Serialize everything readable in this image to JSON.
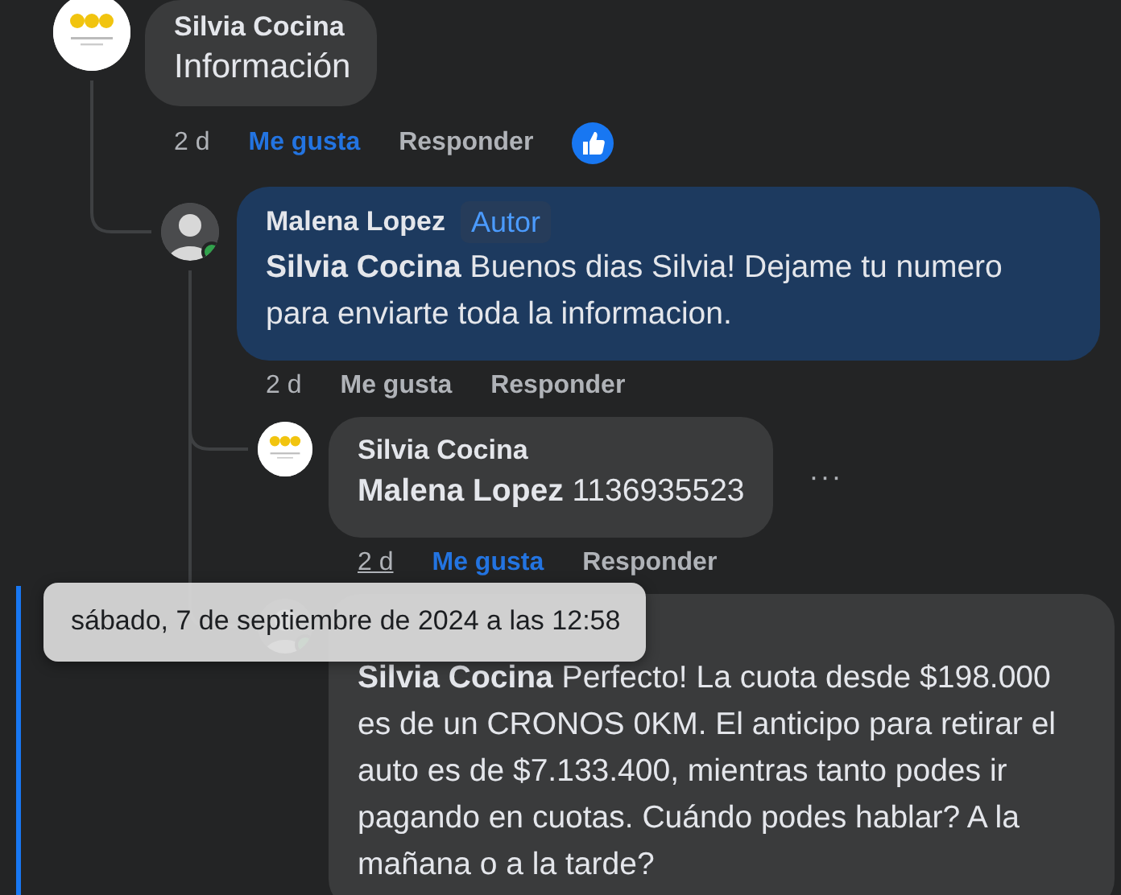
{
  "comments": [
    {
      "author": "Silvia Cocina",
      "avatar": {
        "kind": "logo"
      },
      "by_author": false,
      "text": "Información",
      "time": "2 d",
      "time_hovered": false,
      "like_label": "Me gusta",
      "liked": true,
      "reply_label": "Responder",
      "reactions": [
        {
          "kind": "like"
        }
      ],
      "children": [
        {
          "author": "Malena Lopez",
          "badge": "Autor",
          "avatar": {
            "kind": "person"
          },
          "online": true,
          "by_author": true,
          "text": "**Silvia Cocina** Buenos dias Silvia! Dejame tu numero para enviarte toda la informacion.",
          "time": "2 d",
          "time_hovered": false,
          "like_label": "Me gusta",
          "liked": false,
          "reply_label": "Responder",
          "children": [
            {
              "author": "Silvia Cocina",
              "avatar": {
                "kind": "logo"
              },
              "by_author": false,
              "text": "**Malena Lopez** 1136935523",
              "menu": "···",
              "time": "2 d",
              "time_hovered": true,
              "like_label": "Me gusta",
              "liked": true,
              "reply_label": "Responder"
            },
            {
              "avatar": {
                "kind": "person"
              },
              "online": true,
              "by_author": false,
              "highlighted": true,
              "text": "**Silvia Cocina** Perfecto! La cuota desde $198.000 es de un CRONOS 0KM. El anticipo para retirar el auto es de $7.133.400, mientras tanto podes ir pagando en cuotas. Cuándo podes hablar? A la mañana o a la tarde?"
            }
          ]
        }
      ]
    }
  ],
  "tooltip": {
    "text": "sábado, 7 de septiembre de 2024 a las 12:58"
  }
}
